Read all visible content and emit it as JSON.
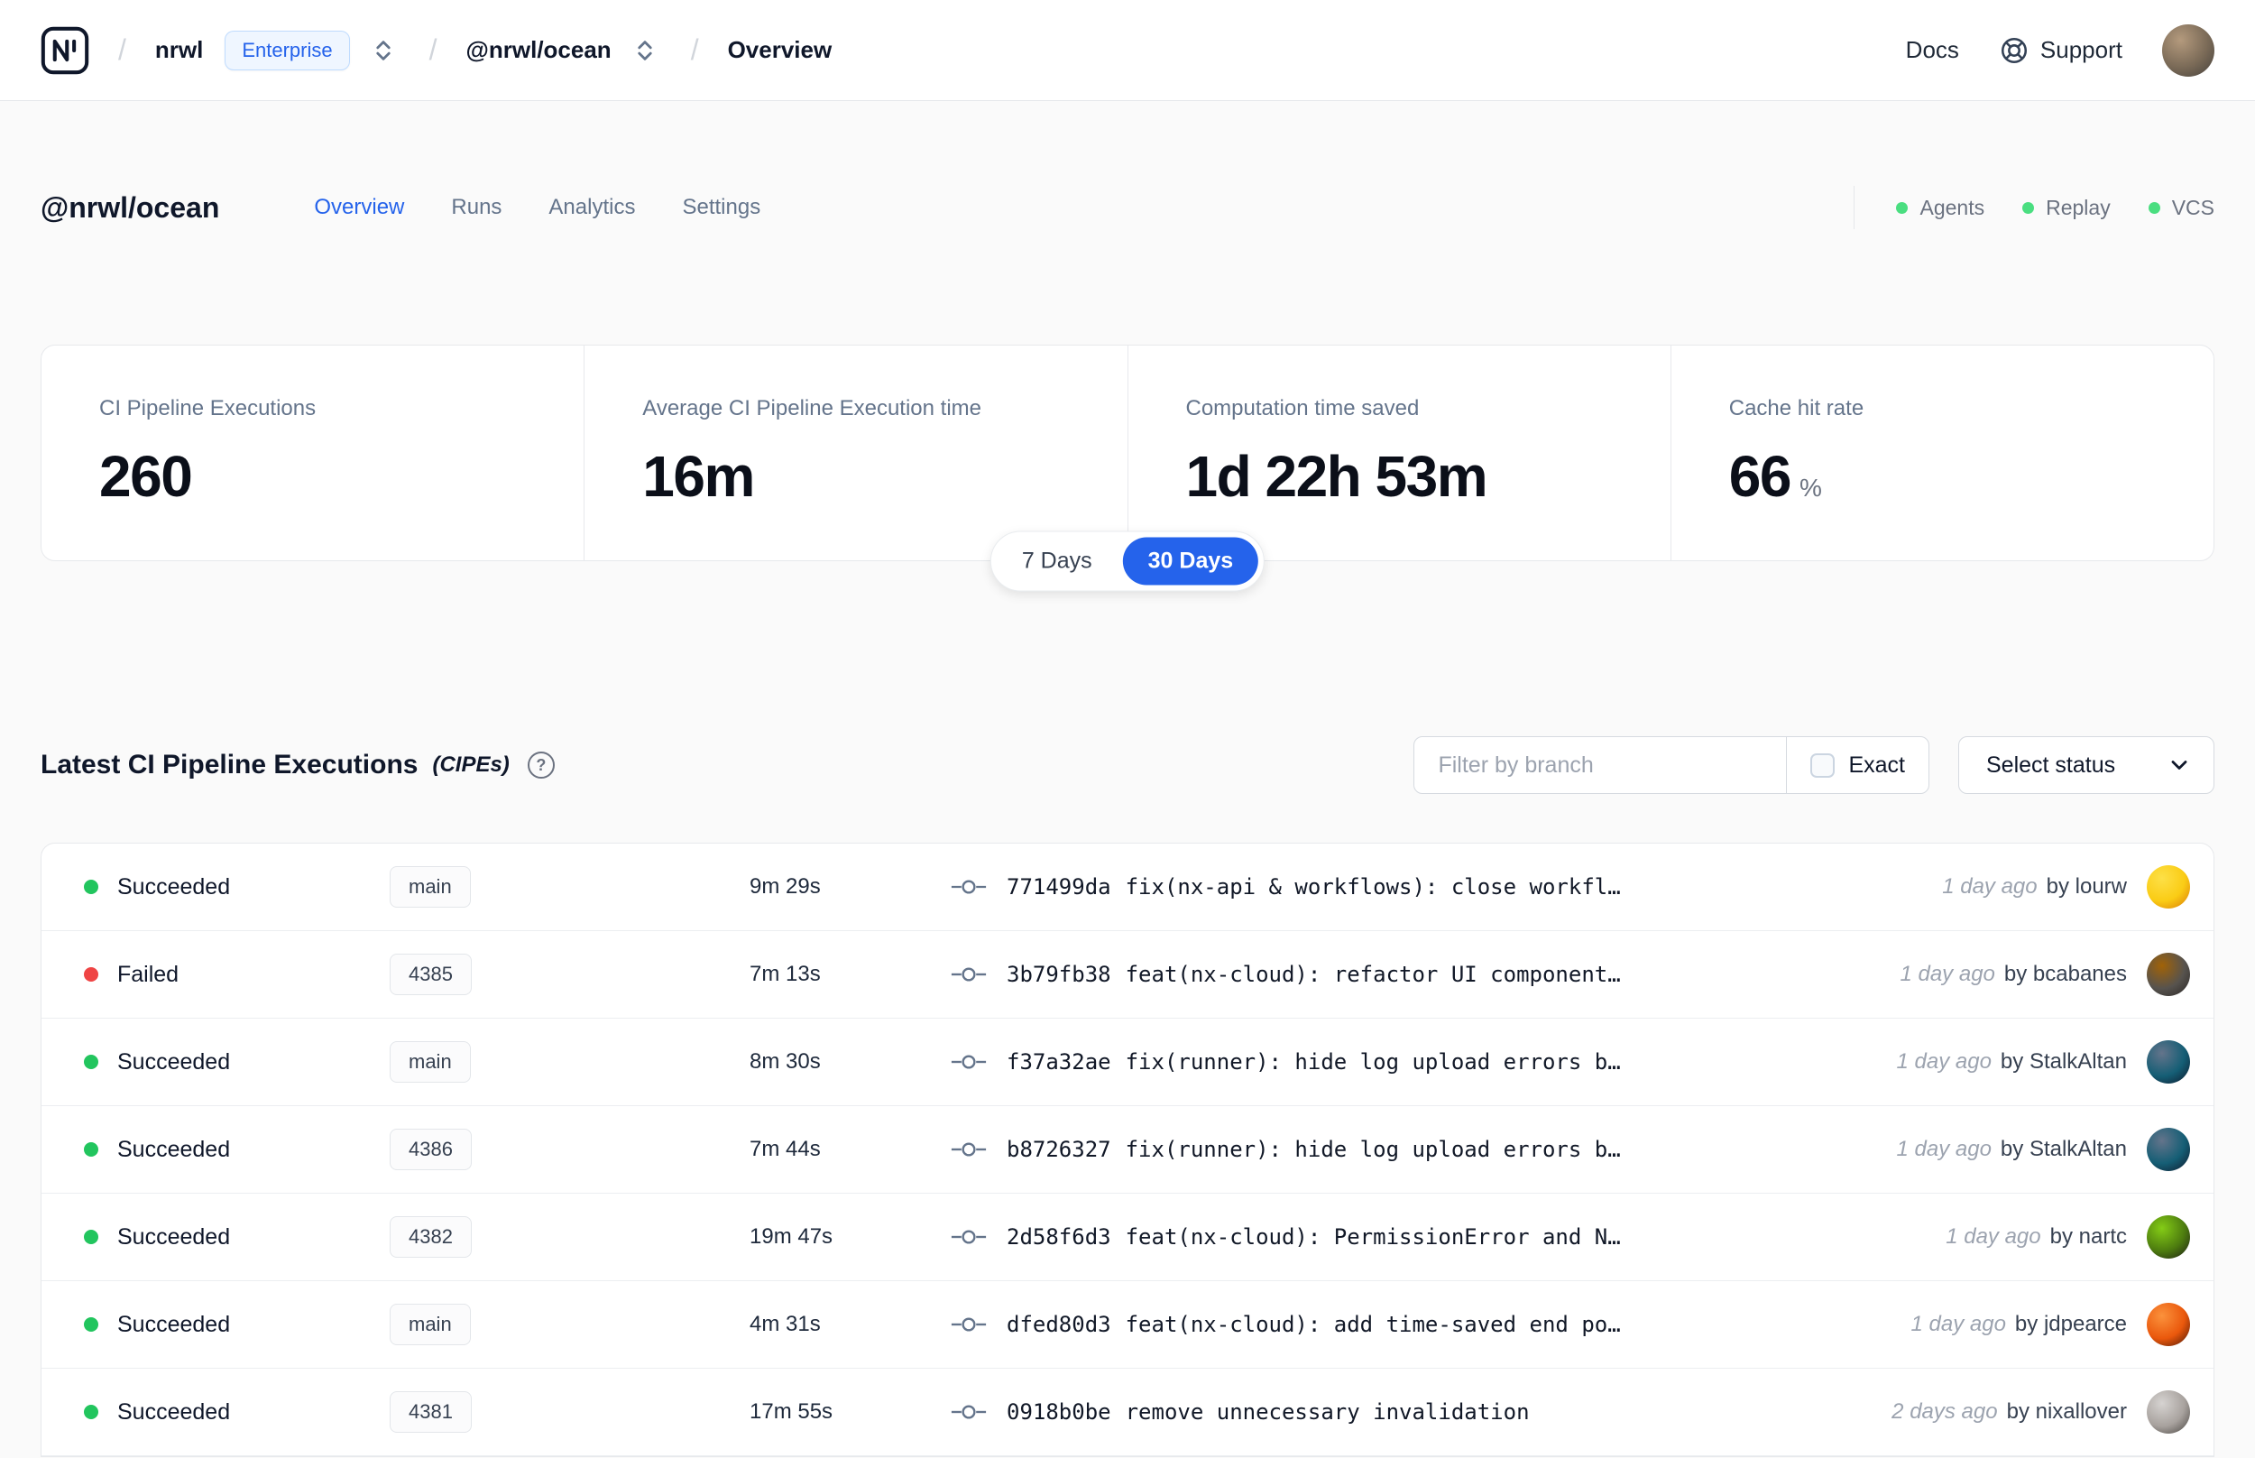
{
  "navbar": {
    "separator": "/",
    "org": "nrwl",
    "org_badge": "Enterprise",
    "workspace": "@nrwl/ocean",
    "page": "Overview",
    "docs_label": "Docs",
    "support_label": "Support"
  },
  "workspace_header": {
    "title": "@nrwl/ocean",
    "tabs": [
      {
        "label": "Overview",
        "active": true
      },
      {
        "label": "Runs",
        "active": false
      },
      {
        "label": "Analytics",
        "active": false
      },
      {
        "label": "Settings",
        "active": false
      }
    ],
    "indicators": [
      {
        "label": "Agents"
      },
      {
        "label": "Replay"
      },
      {
        "label": "VCS"
      }
    ]
  },
  "stats": {
    "cards": [
      {
        "label": "CI Pipeline Executions",
        "value": "260",
        "suffix": ""
      },
      {
        "label": "Average CI Pipeline Execution time",
        "value": "16m",
        "suffix": ""
      },
      {
        "label": "Computation time saved",
        "value": "1d 22h 53m",
        "suffix": ""
      },
      {
        "label": "Cache hit rate",
        "value": "66",
        "suffix": "%"
      }
    ],
    "range_toggle": [
      {
        "label": "7 Days",
        "active": false
      },
      {
        "label": "30 Days",
        "active": true
      }
    ]
  },
  "cipe_section": {
    "title": "Latest CI Pipeline Executions",
    "title_note": "(CIPEs)",
    "help_icon": "?",
    "filter_placeholder": "Filter by branch",
    "exact_label": "Exact",
    "select_status_label": "Select status",
    "rows": [
      {
        "status_color": "green",
        "status": "Succeeded",
        "branch": "main",
        "duration": "9m 29s",
        "commit": "771499da",
        "message": "fix(nx-api & workflows): close workfl…",
        "time": "1 day ago",
        "author": "by lourw"
      },
      {
        "status_color": "red",
        "status": "Failed",
        "branch": "4385",
        "duration": "7m 13s",
        "commit": "3b79fb38",
        "message": "feat(nx-cloud): refactor UI component…",
        "time": "1 day ago",
        "author": "by bcabanes"
      },
      {
        "status_color": "green",
        "status": "Succeeded",
        "branch": "main",
        "duration": "8m 30s",
        "commit": "f37a32ae",
        "message": "fix(runner): hide log upload errors b…",
        "time": "1 day ago",
        "author": "by StalkAltan"
      },
      {
        "status_color": "green",
        "status": "Succeeded",
        "branch": "4386",
        "duration": "7m 44s",
        "commit": "b8726327",
        "message": "fix(runner): hide log upload errors b…",
        "time": "1 day ago",
        "author": "by StalkAltan"
      },
      {
        "status_color": "green",
        "status": "Succeeded",
        "branch": "4382",
        "duration": "19m 47s",
        "commit": "2d58f6d3",
        "message": "feat(nx-cloud): PermissionError and N…",
        "time": "1 day ago",
        "author": "by nartc"
      },
      {
        "status_color": "green",
        "status": "Succeeded",
        "branch": "main",
        "duration": "4m 31s",
        "commit": "dfed80d3",
        "message": "feat(nx-cloud): add time-saved end po…",
        "time": "1 day ago",
        "author": "by jdpearce"
      },
      {
        "status_color": "green",
        "status": "Succeeded",
        "branch": "4381",
        "duration": "17m 55s",
        "commit": "0918b0be",
        "message": "remove unnecessary invalidation",
        "time": "2 days ago",
        "author": "by nixallover"
      }
    ]
  },
  "colors": {
    "accent": "#2563eb",
    "success": "#22c55e",
    "failure": "#ef4444"
  }
}
